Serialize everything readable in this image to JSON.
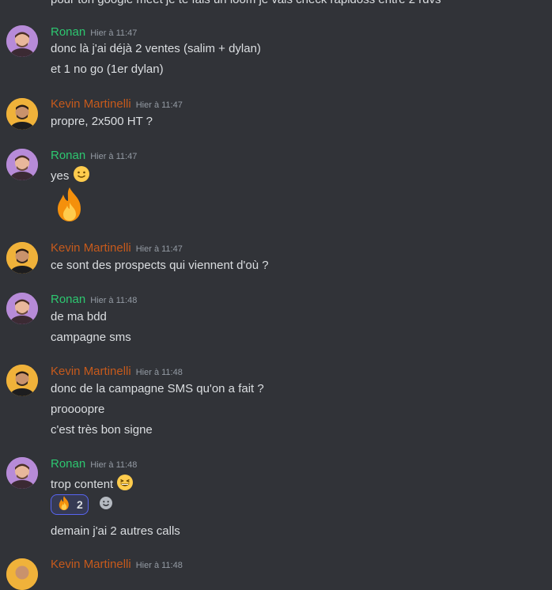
{
  "top_cut_text": "pour ton google meet je te fais un loom je vais check rapidoss entre 2 rdvs",
  "reaction": {
    "emoji": "fire",
    "count": "2"
  },
  "groups": [
    {
      "author": "Ronan",
      "time": "Hier à 11:47",
      "messages": [
        "donc là j'ai déjà 2 ventes (salim + dylan)",
        "et 1 no go (1er dylan)"
      ]
    },
    {
      "author": "Kevin Martinelli",
      "time": "Hier à 11:47",
      "messages": [
        "propre, 2x500 HT ?"
      ]
    },
    {
      "author": "Ronan",
      "time": "Hier à 11:47",
      "messages": [
        "yes"
      ]
    },
    {
      "author": "Kevin Martinelli",
      "time": "Hier à 11:47",
      "messages": [
        "ce sont des prospects qui viennent d'où ?"
      ]
    },
    {
      "author": "Ronan",
      "time": "Hier à 11:48",
      "messages": [
        "de ma bdd",
        "campagne sms"
      ]
    },
    {
      "author": "Kevin Martinelli",
      "time": "Hier à 11:48",
      "messages": [
        "donc de la campagne SMS qu'on a fait ?",
        "proooopre",
        "c'est très bon signe"
      ]
    },
    {
      "author": "Ronan",
      "time": "Hier à 11:48",
      "messages": [
        "trop content",
        "demain j'ai 2 autres calls"
      ]
    },
    {
      "author": "Kevin Martinelli",
      "time": "Hier à 11:48"
    }
  ],
  "colors": {
    "background": "#313338",
    "ronan": "#2dc770",
    "kevin": "#c65a1c",
    "text": "#dbdee1",
    "timestamp": "#949ba4"
  }
}
